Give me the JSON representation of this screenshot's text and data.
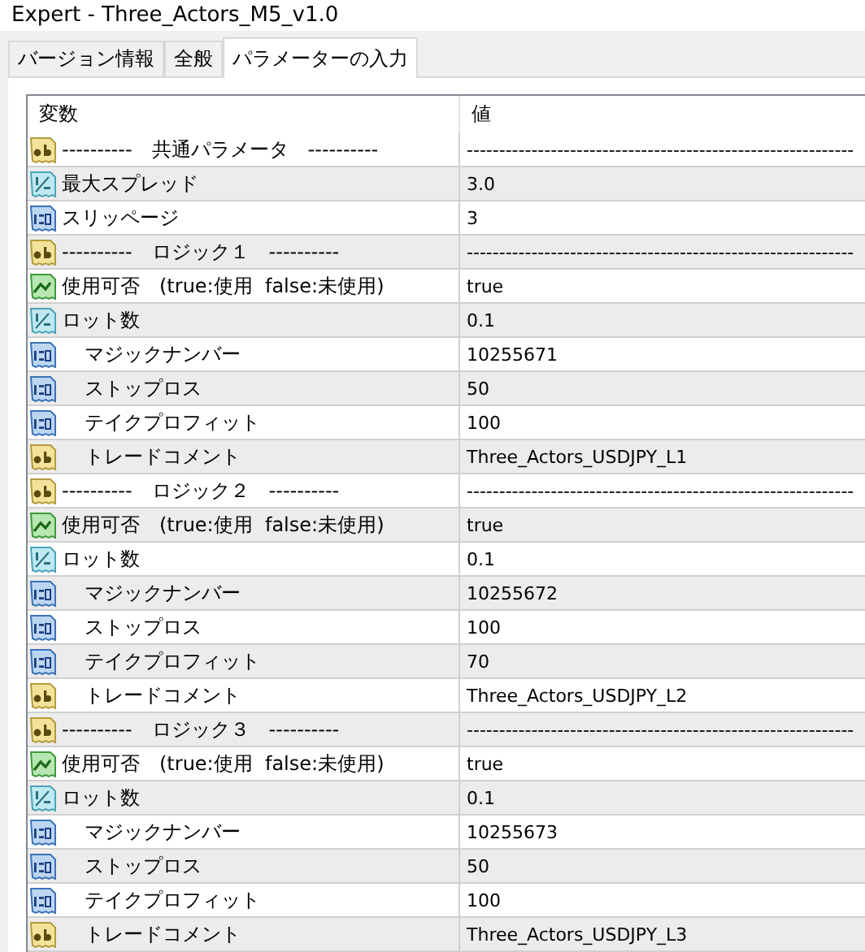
{
  "window": {
    "title": "Expert - Three_Actors_M5_v1.0"
  },
  "tabs": [
    {
      "label": "バージョン情報",
      "selected": false
    },
    {
      "label": "全般",
      "selected": false
    },
    {
      "label": "パラメーターの入力",
      "selected": true
    }
  ],
  "table": {
    "columns": [
      "変数",
      "値"
    ],
    "rows": [
      {
        "kind": "string",
        "indented": false,
        "name": "----------　共通パラメータ　----------",
        "value": "------------------------------------------------------------"
      },
      {
        "kind": "double",
        "indented": false,
        "name": "最大スプレッド",
        "value": "3.0"
      },
      {
        "kind": "int",
        "indented": false,
        "name": "スリッページ",
        "value": "3"
      },
      {
        "kind": "string",
        "indented": false,
        "name": "----------　ロジック１　----------",
        "value": "------------------------------------------------------------"
      },
      {
        "kind": "bool",
        "indented": false,
        "name": "使用可否　(true:使用  false:未使用)",
        "value": "true"
      },
      {
        "kind": "double",
        "indented": false,
        "name": "ロット数",
        "value": "0.1"
      },
      {
        "kind": "int",
        "indented": true,
        "name": "マジックナンバー",
        "value": "10255671"
      },
      {
        "kind": "int",
        "indented": true,
        "name": "ストップロス",
        "value": "50"
      },
      {
        "kind": "int",
        "indented": true,
        "name": "テイクプロフィット",
        "value": "100"
      },
      {
        "kind": "string",
        "indented": true,
        "name": "トレードコメント",
        "value": "Three_Actors_USDJPY_L1"
      },
      {
        "kind": "string",
        "indented": false,
        "name": "----------　ロジック２　----------",
        "value": "------------------------------------------------------------"
      },
      {
        "kind": "bool",
        "indented": false,
        "name": "使用可否　(true:使用  false:未使用)",
        "value": "true"
      },
      {
        "kind": "double",
        "indented": false,
        "name": "ロット数",
        "value": "0.1"
      },
      {
        "kind": "int",
        "indented": true,
        "name": "マジックナンバー",
        "value": "10255672"
      },
      {
        "kind": "int",
        "indented": true,
        "name": "ストップロス",
        "value": "100"
      },
      {
        "kind": "int",
        "indented": true,
        "name": "テイクプロフィット",
        "value": "70"
      },
      {
        "kind": "string",
        "indented": true,
        "name": "トレードコメント",
        "value": "Three_Actors_USDJPY_L2"
      },
      {
        "kind": "string",
        "indented": false,
        "name": "----------　ロジック３　----------",
        "value": "------------------------------------------------------------"
      },
      {
        "kind": "bool",
        "indented": false,
        "name": "使用可否　(true:使用  false:未使用)",
        "value": "true"
      },
      {
        "kind": "double",
        "indented": false,
        "name": "ロット数",
        "value": "0.1"
      },
      {
        "kind": "int",
        "indented": true,
        "name": "マジックナンバー",
        "value": "10255673"
      },
      {
        "kind": "int",
        "indented": true,
        "name": "ストップロス",
        "value": "50"
      },
      {
        "kind": "int",
        "indented": true,
        "name": "テイクプロフィット",
        "value": "100"
      },
      {
        "kind": "string",
        "indented": true,
        "name": "トレードコメント",
        "value": "Three_Actors_USDJPY_L3"
      }
    ]
  }
}
